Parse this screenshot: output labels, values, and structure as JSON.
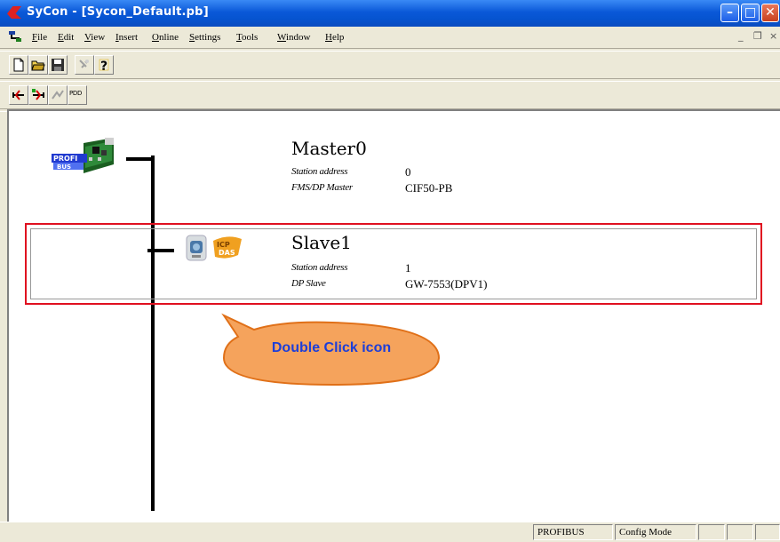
{
  "window": {
    "title": "SyCon - [Sycon_Default.pb]",
    "minimize_glyph": "–",
    "maximize_glyph": "□",
    "close_glyph": "✕"
  },
  "menu": {
    "items": [
      "File",
      "Edit",
      "View",
      "Insert",
      "Online",
      "Settings",
      "Tools",
      "Window",
      "Help"
    ],
    "mdi_minimize": "_",
    "mdi_restore": "❐",
    "mdi_close": "×"
  },
  "toolbar1": [
    "new-document-icon",
    "open-folder-icon",
    "save-disk-icon",
    "help-pointer-icon",
    "help-question-icon"
  ],
  "toolbar2": [
    "insert-master-icon",
    "insert-slave-icon",
    "disabled-network-icon",
    "pdd-icon"
  ],
  "toolbar2_pdd_label": "PDD",
  "master": {
    "name": "Master0",
    "station_address_label": "Station address",
    "station_address": "0",
    "type_label": "FMS/DP Master",
    "device": "CIF50-PB"
  },
  "slave": {
    "name": "Slave1",
    "station_address_label": "Station address",
    "station_address": "1",
    "type_label": "DP Slave",
    "device": "GW-7553(DPV1)"
  },
  "callout": {
    "text": "Double Click icon"
  },
  "status": {
    "protocol": "PROFIBUS",
    "mode": "Config Mode",
    "cells": [
      "",
      "",
      ""
    ]
  },
  "colors": {
    "selection_border": "#e01020",
    "callout_fill": "#f5a35c",
    "callout_text": "#1d3ed8"
  }
}
